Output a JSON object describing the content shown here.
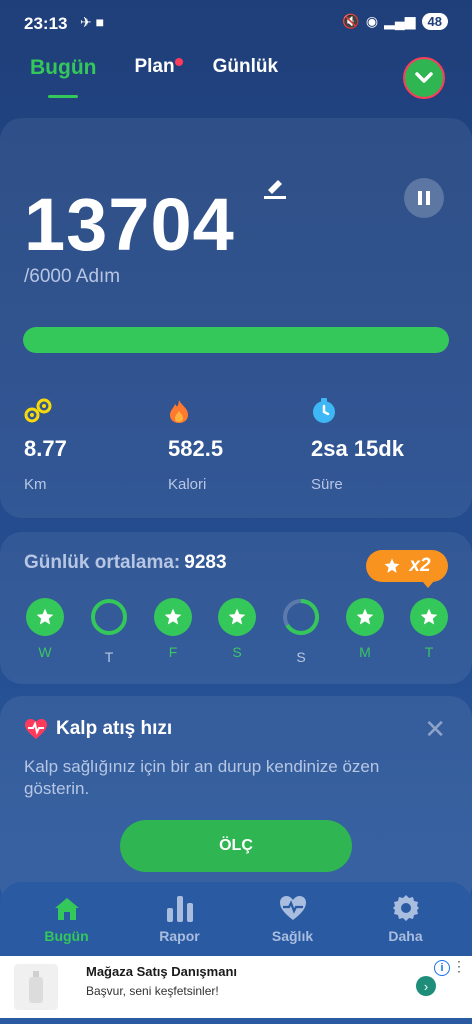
{
  "status_bar": {
    "time": "23:13",
    "battery": "48"
  },
  "tabs": [
    {
      "label": "Bugün",
      "active": true
    },
    {
      "label": "Plan",
      "badge": true
    },
    {
      "label": "Günlük"
    }
  ],
  "steps": {
    "value": "13704",
    "goal": "/6000 Adım",
    "progress_fraction": 1.0
  },
  "metrics": [
    {
      "value": "8.77",
      "label": "Km",
      "icon": "route-icon",
      "color": "#f5d90a"
    },
    {
      "value": "582.5",
      "label": "Kalori",
      "icon": "flame-icon",
      "color": "#ff7a2f"
    },
    {
      "value": "2sa 15dk",
      "label": "Süre",
      "icon": "stopwatch-icon",
      "color": "#3db7f5"
    }
  ],
  "weekly": {
    "title": "Günlük ortalama:",
    "average": "9283",
    "badge": "x2",
    "days": [
      {
        "label": "W",
        "state": "star"
      },
      {
        "label": "T",
        "state": "ring-full"
      },
      {
        "label": "F",
        "state": "star"
      },
      {
        "label": "S",
        "state": "star"
      },
      {
        "label": "S",
        "state": "ring-partial"
      },
      {
        "label": "M",
        "state": "star"
      },
      {
        "label": "T",
        "state": "star"
      }
    ]
  },
  "heart": {
    "title": "Kalp atış hızı",
    "description": "Kalp sağlığınız için bir an durup kendinize özen gösterin.",
    "button": "ÖLÇ"
  },
  "bottom_nav": [
    {
      "label": "Bugün",
      "icon": "home-icon",
      "active": true
    },
    {
      "label": "Rapor",
      "icon": "bar-chart-icon"
    },
    {
      "label": "Sağlık",
      "icon": "heart-pulse-icon"
    },
    {
      "label": "Daha",
      "icon": "gear-icon"
    }
  ],
  "ad": {
    "title": "Mağaza Satış Danışmanı",
    "subtitle": "Başvur, seni keşfetsinler!"
  },
  "colors": {
    "accent": "#34c759",
    "badge": "#f7931e",
    "alert": "#ff3b5c"
  }
}
